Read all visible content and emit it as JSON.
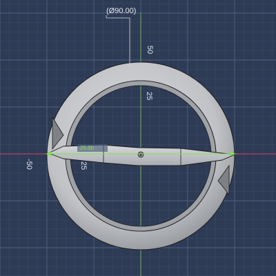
{
  "viewport": {
    "background": "#2e3b55",
    "grid_minor_color": "#3c4a66",
    "grid_major_color": "#52617f",
    "axis_x_color": "#d8445a",
    "axis_y_color": "#6fb36a"
  },
  "model": {
    "body_color": "#c4c6ca",
    "shadow_color": "#8f9297",
    "edge_color": "#1c1c1c"
  },
  "dimension": {
    "diameter_text": "(Ø90.00)",
    "selected_value": "25.00"
  },
  "axis_labels": {
    "y_top": "50",
    "y_mid": "25",
    "x_left": "-50",
    "x_mid": "25"
  }
}
